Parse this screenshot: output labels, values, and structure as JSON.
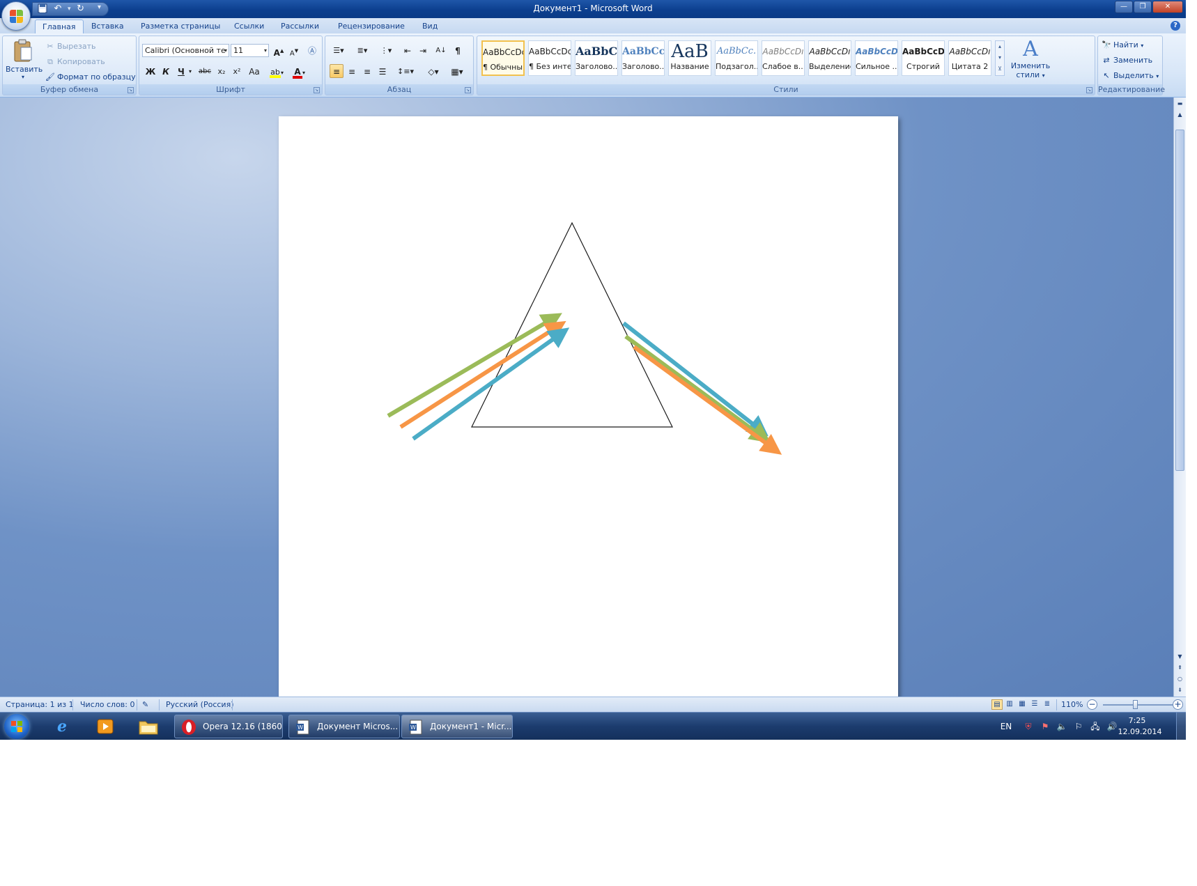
{
  "window": {
    "title": "Документ1 - Microsoft Word",
    "controls": {
      "minimize": "—",
      "maximize": "❐",
      "close": "✕"
    }
  },
  "quick_access": {
    "save_icon": "save-icon",
    "undo_icon": "undo-icon",
    "redo_icon": "redo-icon",
    "customize": "▾"
  },
  "tabs": [
    "Главная",
    "Вставка",
    "Разметка страницы",
    "Ссылки",
    "Рассылки",
    "Рецензирование",
    "Вид"
  ],
  "active_tab": "Главная",
  "help": "?",
  "clipboard": {
    "paste": "Вставить",
    "cut": "Вырезать",
    "copy": "Копировать",
    "format_painter": "Формат по образцу",
    "group_label": "Буфер обмена"
  },
  "font": {
    "font_name": "Calibri (Основной те",
    "font_size": "11",
    "grow": "A",
    "shrink": "A",
    "bold": "Ж",
    "italic": "К",
    "underline": "Ч",
    "strike": "abc",
    "subscript": "x₂",
    "superscript": "x²",
    "change_case": "Aa",
    "font_color": "A",
    "group_label": "Шрифт"
  },
  "paragraph": {
    "pilcrow": "¶",
    "group_label": "Абзац"
  },
  "styles": {
    "items": [
      {
        "sample": "AaBbCcDc",
        "name": "¶ Обычный"
      },
      {
        "sample": "AaBbCcDc",
        "name": "¶ Без инте..."
      },
      {
        "sample": "AaBbC(",
        "name": "Заголово..."
      },
      {
        "sample": "AaBbCc",
        "name": "Заголово..."
      },
      {
        "sample": "AaB",
        "name": "Название"
      },
      {
        "sample": "AaBbCc.",
        "name": "Подзагол..."
      },
      {
        "sample": "AaBbCcDı",
        "name": "Слабое в..."
      },
      {
        "sample": "AaBbCcDı",
        "name": "Выделение"
      },
      {
        "sample": "AaBbCcDı",
        "name": "Сильное ..."
      },
      {
        "sample": "AaBbCcDc",
        "name": "Строгий"
      },
      {
        "sample": "AaBbCcDı",
        "name": "Цитата 2"
      }
    ],
    "change_styles_line1": "Изменить",
    "change_styles_line2": "стили",
    "group_label": "Стили"
  },
  "editing": {
    "find": "Найти",
    "replace": "Заменить",
    "select": "Выделить",
    "group_label": "Редактирование"
  },
  "drawing": {
    "shape": "triangle",
    "arrow_colors": {
      "green": "#9bbb59",
      "orange": "#f79646",
      "blue": "#4bacc6"
    }
  },
  "status": {
    "page": "Страница: 1 из 1",
    "words": "Число слов: 0",
    "language": "Русский (Россия)",
    "zoom": "110%",
    "zoom_minus": "−",
    "zoom_plus": "+"
  },
  "taskbar": {
    "tasks": [
      {
        "label": "Opera 12.16 (1860...",
        "icon": "opera-icon"
      },
      {
        "label": "Документ Micros...",
        "icon": "word-icon"
      },
      {
        "label": "Документ1 - Micr...",
        "icon": "word-icon"
      }
    ],
    "language": "EN",
    "time": "7:25",
    "date": "12.09.2014"
  }
}
